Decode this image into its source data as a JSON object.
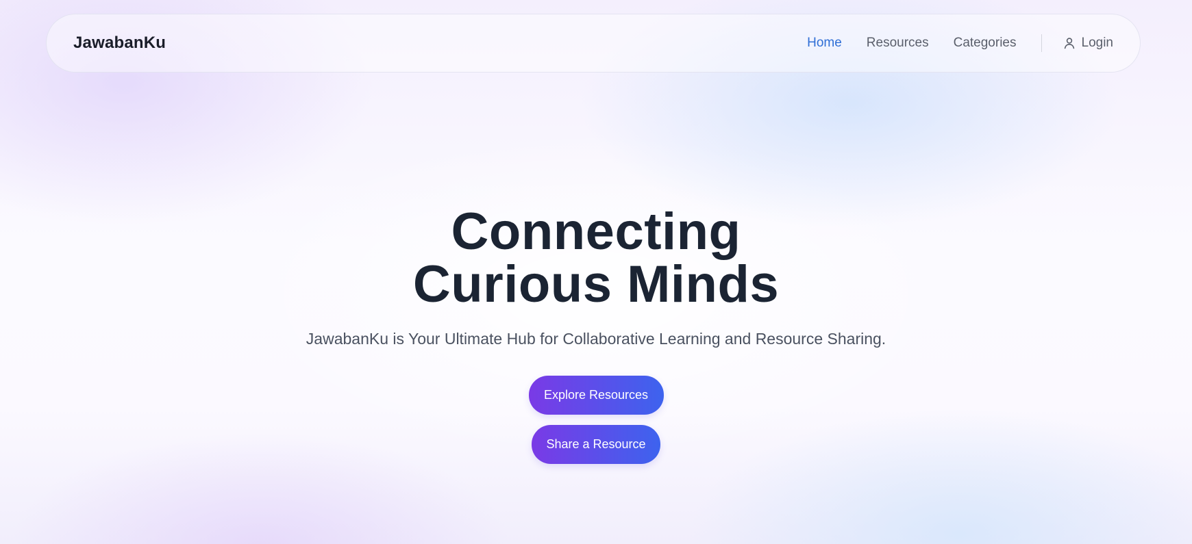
{
  "header": {
    "brand": "JawabanKu",
    "nav": [
      {
        "label": "Home",
        "active": true
      },
      {
        "label": "Resources",
        "active": false
      },
      {
        "label": "Categories",
        "active": false
      }
    ],
    "login_label": "Login",
    "login_icon": "user-icon"
  },
  "hero": {
    "title_line1": "Connecting",
    "title_line2": "Curious Minds",
    "subtitle": "JawabanKu is Your Ultimate Hub for Collaborative Learning and Resource Sharing.",
    "primary_cta": "Explore Resources",
    "secondary_cta": "Share a Resource"
  },
  "colors": {
    "accent_link": "#2f6fd6",
    "button_gradient_start": "#7a3ae6",
    "button_gradient_end": "#3d63ee",
    "heading": "#1b2433"
  }
}
